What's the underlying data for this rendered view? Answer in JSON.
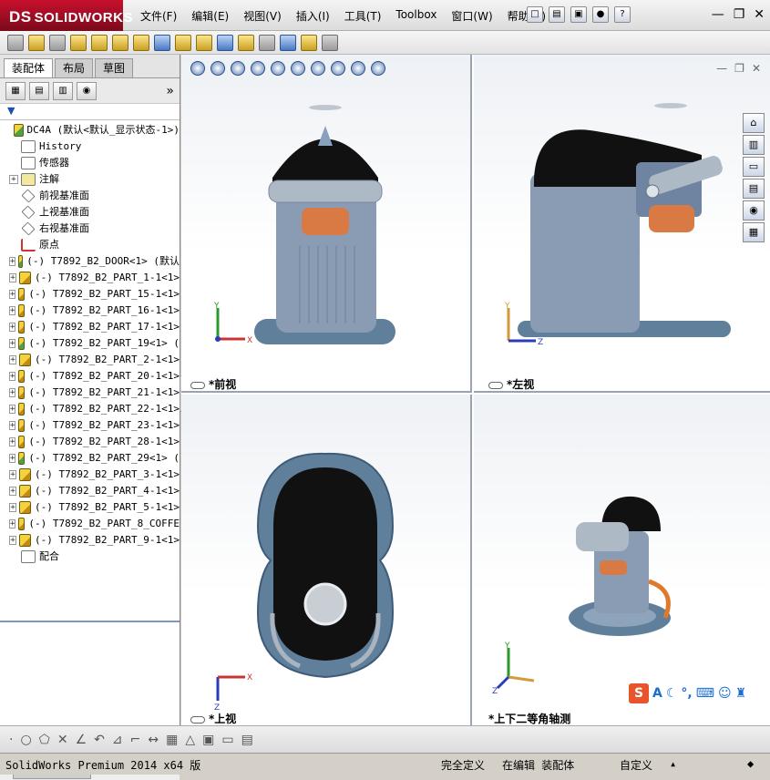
{
  "app": {
    "logo_prefix": "DS",
    "logo_text": "SOLIDWORKS"
  },
  "menu": [
    "文件(F)",
    "编辑(E)",
    "视图(V)",
    "插入(I)",
    "工具(T)",
    "Toolbox",
    "窗口(W)",
    "帮助(H)"
  ],
  "left_panel": {
    "tabs": [
      "装配体",
      "布局",
      "草图"
    ],
    "active_tab": "装配体",
    "filter_icon": "filter-icon",
    "tree": [
      {
        "label": "DC4A  (默认<默认_显示状态-1>)",
        "icon": "asm",
        "expand": false,
        "indent": 0
      },
      {
        "label": "History",
        "icon": "hist",
        "expand": false,
        "indent": 1
      },
      {
        "label": "传感器",
        "icon": "hist",
        "expand": false,
        "indent": 1
      },
      {
        "label": "注解",
        "icon": "ann",
        "expand": true,
        "indent": 1
      },
      {
        "label": "前视基准面",
        "icon": "plane",
        "expand": false,
        "indent": 1
      },
      {
        "label": "上视基准面",
        "icon": "plane",
        "expand": false,
        "indent": 1
      },
      {
        "label": "右视基准面",
        "icon": "plane",
        "expand": false,
        "indent": 1
      },
      {
        "label": "原点",
        "icon": "orig",
        "expand": false,
        "indent": 1
      },
      {
        "label": "(-) T7892_B2_DOOR<1> (默认",
        "icon": "asm",
        "expand": true,
        "indent": 1
      },
      {
        "label": "(-) T7892_B2_PART_1-1<1>",
        "icon": "part",
        "expand": true,
        "indent": 1
      },
      {
        "label": "(-) T7892_B2_PART_15-1<1>",
        "icon": "part",
        "expand": true,
        "indent": 1
      },
      {
        "label": "(-) T7892_B2_PART_16-1<1>",
        "icon": "part",
        "expand": true,
        "indent": 1
      },
      {
        "label": "(-) T7892_B2_PART_17-1<1>",
        "icon": "part",
        "expand": true,
        "indent": 1
      },
      {
        "label": "(-) T7892_B2_PART_19<1> (",
        "icon": "asm",
        "expand": true,
        "indent": 1
      },
      {
        "label": "(-) T7892_B2_PART_2-1<1>",
        "icon": "part",
        "expand": true,
        "indent": 1
      },
      {
        "label": "(-) T7892_B2_PART_20-1<1>",
        "icon": "part",
        "expand": true,
        "indent": 1
      },
      {
        "label": "(-) T7892_B2_PART_21-1<1>",
        "icon": "part",
        "expand": true,
        "indent": 1
      },
      {
        "label": "(-) T7892_B2_PART_22-1<1>",
        "icon": "part",
        "expand": true,
        "indent": 1
      },
      {
        "label": "(-) T7892_B2_PART_23-1<1>",
        "icon": "part",
        "expand": true,
        "indent": 1
      },
      {
        "label": "(-) T7892_B2_PART_28-1<1>",
        "icon": "part",
        "expand": true,
        "indent": 1
      },
      {
        "label": "(-) T7892_B2_PART_29<1> (",
        "icon": "asm",
        "expand": true,
        "indent": 1
      },
      {
        "label": "(-) T7892_B2_PART_3-1<1>",
        "icon": "part",
        "expand": true,
        "indent": 1
      },
      {
        "label": "(-) T7892_B2_PART_4-1<1>",
        "icon": "part",
        "expand": true,
        "indent": 1
      },
      {
        "label": "(-) T7892_B2_PART_5-1<1>",
        "icon": "part",
        "expand": true,
        "indent": 1
      },
      {
        "label": "(-) T7892_B2_PART_8_COFFE",
        "icon": "part",
        "expand": true,
        "indent": 1
      },
      {
        "label": "(-) T7892_B2_PART_9-1<1>",
        "icon": "part",
        "expand": true,
        "indent": 1
      },
      {
        "label": "配合",
        "icon": "hist",
        "expand": false,
        "indent": 1
      }
    ]
  },
  "viewports": {
    "front": "*前视",
    "left": "*左视",
    "top": "*上视",
    "iso": "*上下二等角轴测"
  },
  "axes": {
    "x": "X",
    "y": "Y",
    "z": "Z"
  },
  "status": {
    "product": "SolidWorks Premium 2014 x64 版",
    "defined": "完全定义",
    "editing": "在编辑 装配体",
    "custom": "自定义"
  },
  "ime": {
    "s": "S",
    "a": "A"
  },
  "colors": {
    "brand": "#c8102e",
    "body": "#8a9cb4",
    "base": "#5f7f9a",
    "cap": "#111111",
    "copper": "#d97a44"
  }
}
